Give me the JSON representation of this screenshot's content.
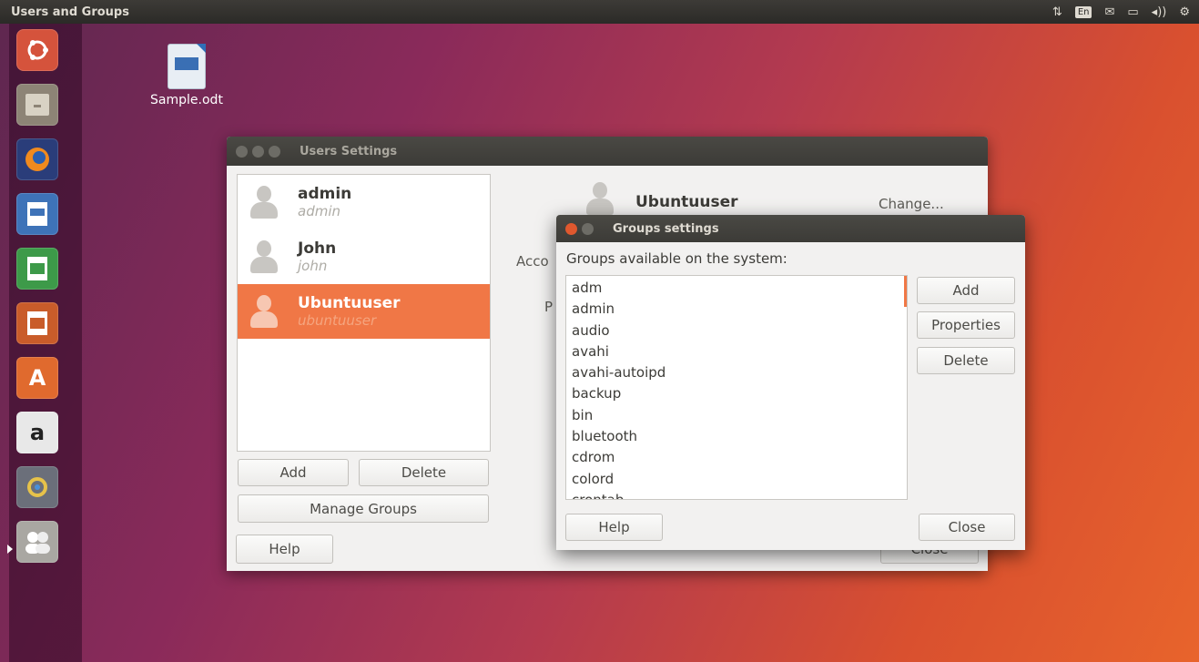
{
  "top_panel": {
    "app_title": "Users and Groups",
    "tray": {
      "network_icon": "network-updown-icon",
      "keyboard_label": "En",
      "mail_icon": "mail-icon",
      "battery_icon": "battery-icon",
      "volume_icon": "volume-icon",
      "settings_icon": "gear-icon"
    }
  },
  "launcher": {
    "items": [
      "ubuntu-dash",
      "files",
      "firefox",
      "writer",
      "calc",
      "impress",
      "software-center",
      "amazon",
      "system-settings",
      "users-and-groups"
    ]
  },
  "desktop": {
    "icons": [
      {
        "label": "Sample.odt"
      }
    ]
  },
  "users_window": {
    "title": "Users Settings",
    "users": [
      {
        "name": "admin",
        "login": "admin"
      },
      {
        "name": "John",
        "login": "john"
      },
      {
        "name": "Ubuntuuser",
        "login": "ubuntuuser"
      }
    ],
    "selected_user": "Ubuntuuser",
    "add_label": "Add",
    "delete_label": "Delete",
    "manage_groups_label": "Manage Groups",
    "help_label": "Help",
    "close_label": "Close",
    "detail": {
      "name": "Ubuntuuser",
      "change_label": "Change...",
      "account_label_partial": "Acco",
      "p_label_partial": "P"
    }
  },
  "groups_dialog": {
    "title": "Groups settings",
    "caption": "Groups available on the system:",
    "groups": [
      "adm",
      "admin",
      "audio",
      "avahi",
      "avahi-autoipd",
      "backup",
      "bin",
      "bluetooth",
      "cdrom",
      "colord",
      "crontab"
    ],
    "add_label": "Add",
    "properties_label": "Properties",
    "delete_label": "Delete",
    "help_label": "Help",
    "close_label": "Close"
  },
  "colors": {
    "accent": "#f07746",
    "panel": "#3c3b37"
  }
}
